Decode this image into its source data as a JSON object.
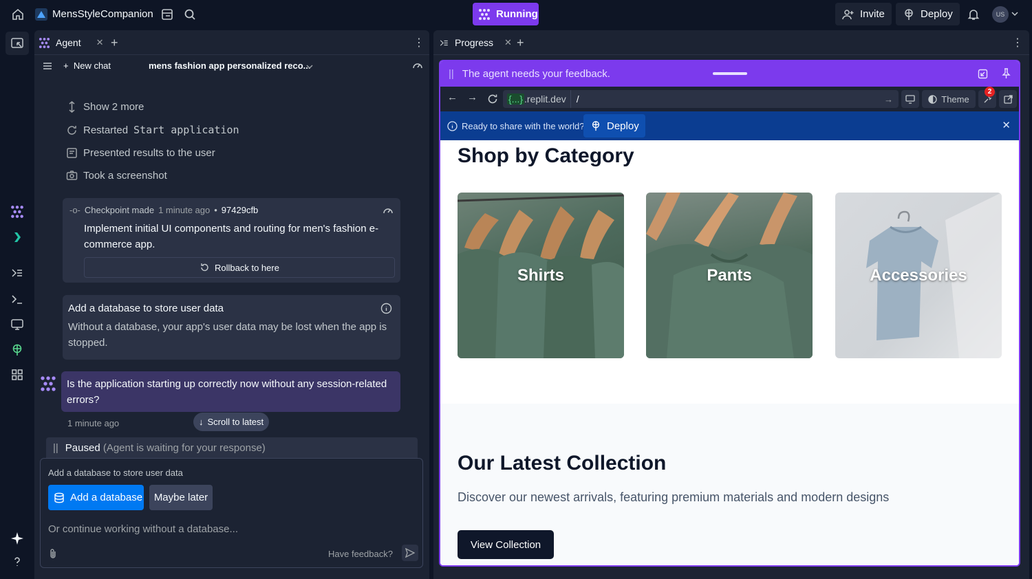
{
  "topbar": {
    "app_name": "MensStyleCompanion",
    "status": "Running",
    "invite_label": "Invite",
    "deploy_label": "Deploy",
    "avatar_initials": "US"
  },
  "agent_panel": {
    "tab_label": "Agent",
    "new_chat_label": "New chat",
    "chat_title": "mens fashion app personalized reco...",
    "actions": [
      {
        "label": "Show 2 more",
        "icon": "expand-icon"
      },
      {
        "label": "Restarted",
        "code": "Start application",
        "icon": "restart-icon"
      },
      {
        "label": "Presented results to the user",
        "icon": "present-icon"
      },
      {
        "label": "Took a screenshot",
        "icon": "camera-icon"
      }
    ],
    "checkpoint": {
      "label": "Checkpoint made",
      "time": "1 minute ago",
      "hash": "97429cfb",
      "description": "Implement initial UI components and routing for men's fashion e-commerce app.",
      "rollback_label": "Rollback to here"
    },
    "db_card": {
      "title": "Add a database to store user data",
      "body": "Without a database, your app's user data may be lost when the app is stopped."
    },
    "question": {
      "text": "Is the application starting up correctly now without any session-related errors?",
      "time": "1 minute ago"
    },
    "scroll_latest_label": "Scroll to latest",
    "paused": {
      "label": "Paused",
      "detail": "(Agent is waiting for your response)"
    },
    "input": {
      "label": "Add a database to store user data",
      "add_db_label": "Add a database",
      "later_label": "Maybe later",
      "placeholder": "Or continue working without a database...",
      "feedback_label": "Have feedback?"
    }
  },
  "progress_panel": {
    "tab_label": "Progress",
    "feedback_bar_text": "The agent needs your feedback.",
    "url": {
      "domain_bracket": "{...}",
      "domain_suffix": ".replit.dev",
      "path": "/"
    },
    "theme_label": "Theme",
    "badge_count": "2",
    "share_text": "Ready to share with the world?",
    "share_deploy_label": "Deploy",
    "site": {
      "shop_title": "Shop by Category",
      "categories": [
        {
          "label": "Shirts"
        },
        {
          "label": "Pants"
        },
        {
          "label": "Accessories"
        }
      ],
      "latest_title": "Our Latest Collection",
      "latest_sub": "Discover our newest arrivals, featuring premium materials and modern designs",
      "view_button": "View Collection"
    }
  },
  "colors": {
    "accent_purple": "#7c3aed",
    "primary_blue": "#0079f2",
    "bg_dark": "#0e1525",
    "panel": "#1c2333"
  }
}
